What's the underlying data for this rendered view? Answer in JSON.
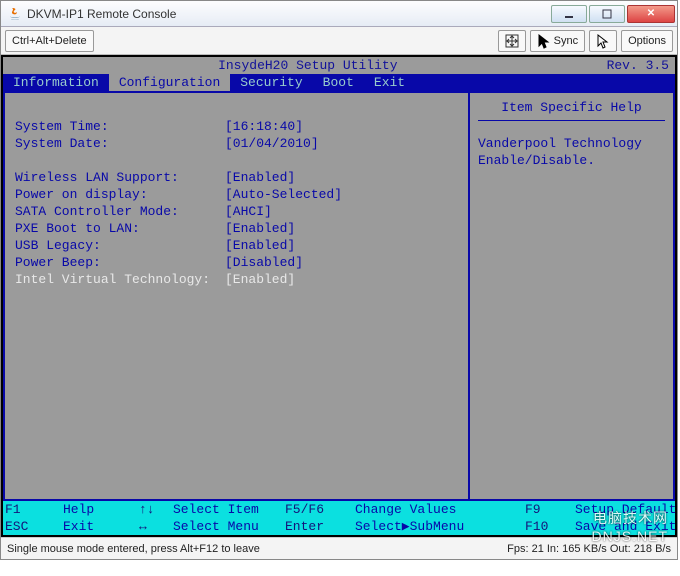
{
  "window": {
    "title": "DKVM-IP1 Remote Console",
    "ctrl_alt_del": "Ctrl+Alt+Delete",
    "sync": "Sync",
    "options": "Options"
  },
  "bios": {
    "header": {
      "title": "InsydeH20 Setup Utility",
      "rev": "Rev. 3.5"
    },
    "tabs": {
      "info": "Information",
      "config": "Configuration",
      "security": "Security",
      "boot": "Boot",
      "exit": "Exit"
    },
    "fields": {
      "system_time": {
        "label": "System Time:",
        "value": "[16:18:40]"
      },
      "system_date": {
        "label": "System Date:",
        "value": "[01/04/2010]"
      },
      "wlan": {
        "label": "Wireless LAN Support:",
        "value": "[Enabled]"
      },
      "power_display": {
        "label": "Power on display:",
        "value": "[Auto-Selected]"
      },
      "sata": {
        "label": "SATA Controller Mode:",
        "value": "[AHCI]"
      },
      "pxe": {
        "label": "PXE Boot to LAN:",
        "value": "[Enabled]"
      },
      "usb": {
        "label": "USB Legacy:",
        "value": "[Enabled]"
      },
      "beep": {
        "label": "Power Beep:",
        "value": "[Disabled]"
      },
      "ivt": {
        "label": "Intel Virtual Technology:",
        "value": "[Enabled]"
      }
    },
    "help": {
      "title": "Item Specific Help",
      "text1": "Vanderpool Technology",
      "text2": "Enable/Disable."
    },
    "footer": {
      "f1": "F1",
      "help": "Help",
      "ud": "↑↓",
      "select_item": "Select Item",
      "f5f6": "F5/F6",
      "change_values": "Change Values",
      "f9": "F9",
      "setup_default": "Setup Default",
      "esc": "ESC",
      "exit": "Exit",
      "lr": "↔",
      "select_menu": "Select Menu",
      "enter": "Enter",
      "select_submenu": "Select▶SubMenu",
      "f10": "F10",
      "save_exit": "Save and Exit"
    }
  },
  "status": {
    "left": "Single mouse mode entered, press Alt+F12 to leave",
    "right": "Fps: 21 In: 165 KB/s Out: 218 B/s"
  },
  "watermark": "电脑技术网\nDNJS.NET"
}
